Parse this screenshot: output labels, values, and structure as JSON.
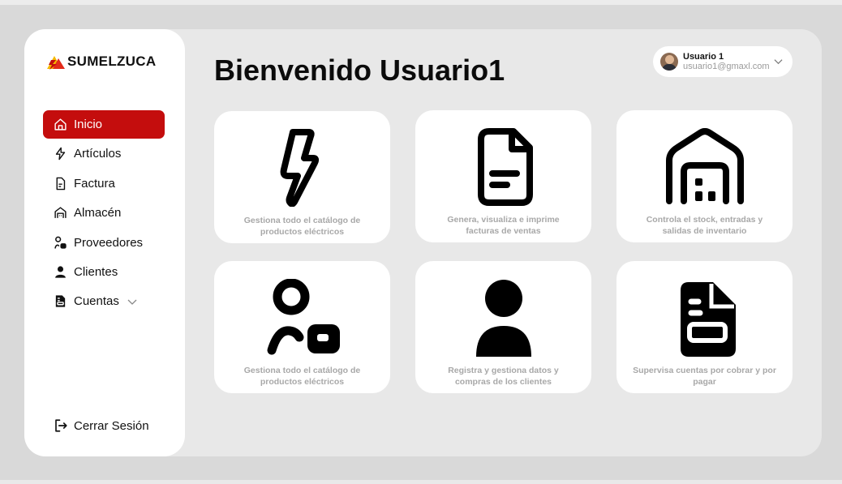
{
  "brand": {
    "name": "SUMELZUCA"
  },
  "page": {
    "title": "Bienvenido Usuario1"
  },
  "user": {
    "name": "Usuario 1",
    "email": "usuario1@gmaxl.com"
  },
  "sidebar": {
    "items": [
      {
        "label": "Inicio",
        "icon": "home-icon",
        "active": true
      },
      {
        "label": "Artículos",
        "icon": "bolt-icon"
      },
      {
        "label": "Factura",
        "icon": "document-icon"
      },
      {
        "label": "Almacén",
        "icon": "warehouse-icon"
      },
      {
        "label": "Proveedores",
        "icon": "supplier-icon"
      },
      {
        "label": "Clientes",
        "icon": "user-icon"
      },
      {
        "label": "Cuentas",
        "icon": "accounts-icon",
        "expandable": true
      }
    ],
    "logout": "Cerrar Sesión"
  },
  "cards": [
    {
      "icon": "bolt-icon",
      "description": "Gestiona todo el catálogo de productos eléctricos"
    },
    {
      "icon": "document-icon",
      "description": "Genera, visualiza e imprime facturas de ventas"
    },
    {
      "icon": "warehouse-icon",
      "description": "Controla el stock, entradas y salidas de inventario"
    },
    {
      "icon": "supplier-icon",
      "description": "Gestiona todo el catálogo de productos eléctricos"
    },
    {
      "icon": "user-icon",
      "description": "Registra y gestiona datos y compras de los clientes"
    },
    {
      "icon": "accounts-icon",
      "description": "Supervisa cuentas por cobrar y por pagar"
    }
  ],
  "colors": {
    "accent": "#c40d0d",
    "logo_yellow": "#f5b800",
    "background": "#e8e8e8"
  }
}
